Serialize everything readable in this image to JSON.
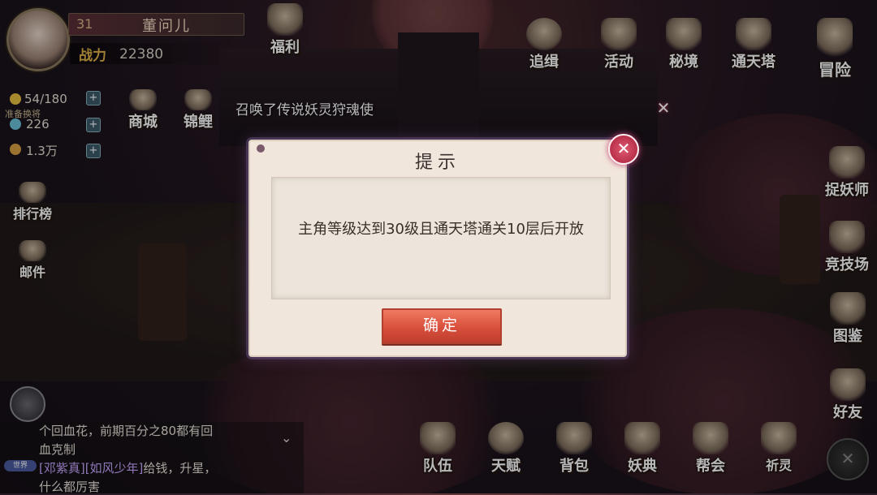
{
  "player": {
    "level": "31",
    "name": "董问儿",
    "power_label": "战力",
    "power_value": "22380"
  },
  "resources": [
    {
      "name": "stamina",
      "icon": "lightning-icon",
      "value": "54/180",
      "sub": "准备换将"
    },
    {
      "name": "jade",
      "icon": "jade-icon",
      "value": "226"
    },
    {
      "name": "gold",
      "icon": "coin-icon",
      "value": "1.3万"
    }
  ],
  "top_menu": [
    "福利",
    "追缉",
    "活动",
    "秘境",
    "通天塔",
    "冒险"
  ],
  "left_menu": [
    "商城",
    "锦鲤",
    "排行榜",
    "邮件"
  ],
  "right_menu": [
    "捉妖师",
    "竞技场",
    "图鉴",
    "好友"
  ],
  "bottom_menu": [
    "队伍",
    "天赋",
    "背包",
    "妖典",
    "帮会",
    "祈灵"
  ],
  "notice": {
    "text": "召唤了传说妖灵狩魂使"
  },
  "dialog": {
    "title": "提示",
    "message": "主角等级达到30级且通天塔通关10层后开放",
    "confirm_label": "确定"
  },
  "chat": {
    "channel": "世界",
    "lines": [
      "个回血花，前期百分之80都有回",
      "血克制"
    ],
    "last_players": "[邓紫真][如风少年]",
    "last_text": "给钱，升星，",
    "last_line2": "什么都厉害"
  },
  "colors": {
    "confirm": "#d8503c",
    "close": "#b8304a",
    "dialog_bg": "#f1e6dc"
  }
}
